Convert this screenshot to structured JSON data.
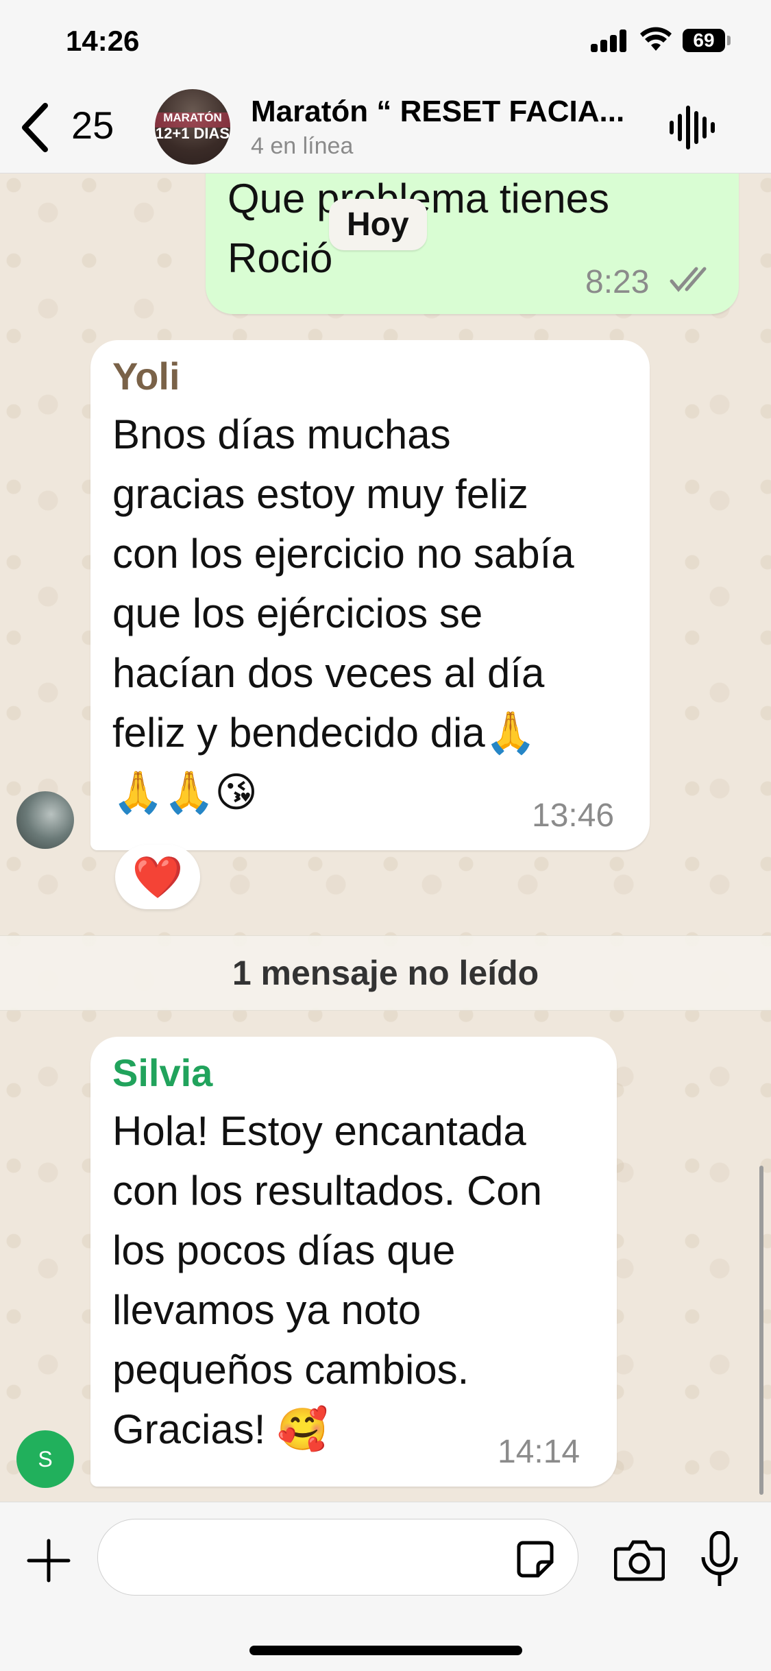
{
  "status_bar": {
    "time": "14:26",
    "battery": "69",
    "icons": [
      "signal-icon",
      "wifi-icon",
      "battery-icon"
    ]
  },
  "header": {
    "back_count": "25",
    "title": "Maratón “ RESET FACIA...",
    "subtitle": "4 en línea",
    "avatar_text_top": "MARATÓN",
    "avatar_text_bottom": "12+1 DIAS",
    "icons": [
      "chevron-left-icon",
      "group-avatar",
      "audio-wave-icon"
    ]
  },
  "day_separator": "Hoy",
  "messages": [
    {
      "direction": "outgoing",
      "text_lines": [
        "Que problema tienes",
        "Roció"
      ],
      "time": "8:23",
      "status": "read"
    },
    {
      "direction": "incoming",
      "sender": "Yoli",
      "sender_color": "#7a6248",
      "text_lines": [
        "Bnos días muchas",
        "gracias estoy muy feliz",
        "con los ejercicio no sabía",
        "que los ejércicios se",
        "hacían dos veces al día",
        "feliz y bendecido dia🙏",
        "🙏🙏😘"
      ],
      "time": "13:46",
      "reaction": "❤️"
    },
    {
      "direction": "incoming",
      "sender": "Silvia",
      "sender_color": "#21a35c",
      "avatar_letter": "S",
      "text_lines": [
        "Hola! Estoy encantada",
        "con los resultados. Con",
        "los pocos días que",
        "llevamos ya noto",
        "pequeños cambios.",
        "Gracias! 🥰"
      ],
      "time": "14:14"
    }
  ],
  "unread_banner": "1 mensaje no leído",
  "input_bar": {
    "placeholder": "",
    "icons": [
      "plus-icon",
      "sticker-icon",
      "camera-icon",
      "microphone-icon"
    ]
  },
  "colors": {
    "outgoing_bubble": "#d9fdd3",
    "incoming_bubble": "#ffffff",
    "chat_background": "#efe7dc",
    "accent_green": "#21b05c"
  }
}
